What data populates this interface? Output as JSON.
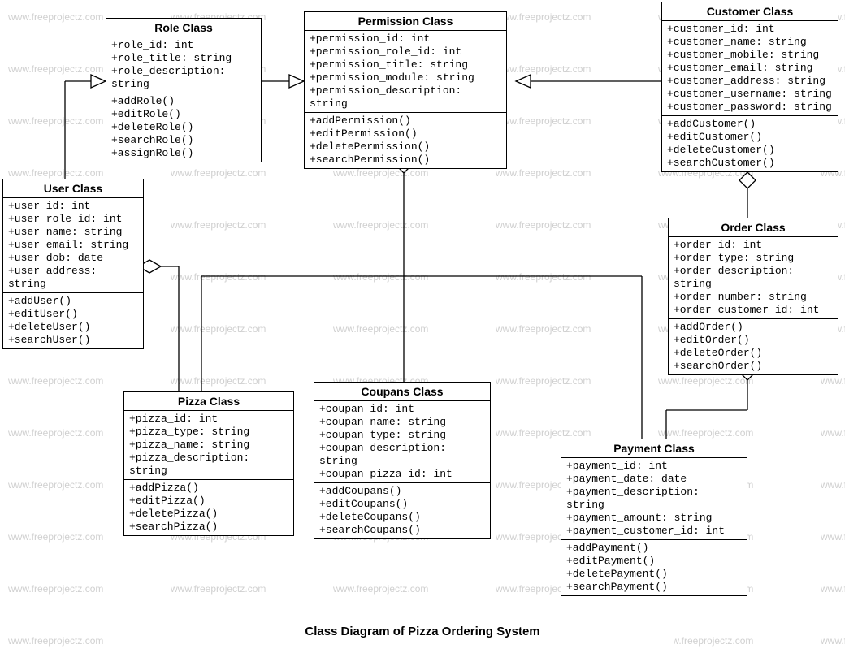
{
  "watermark": "www.freeprojectz.com",
  "caption": "Class Diagram of Pizza Ordering System",
  "classes": {
    "role": {
      "title": "Role Class",
      "attrs": [
        "+role_id: int",
        "+role_title: string",
        "+role_description: string"
      ],
      "ops": [
        "+addRole()",
        "+editRole()",
        "+deleteRole()",
        "+searchRole()",
        "+assignRole()"
      ]
    },
    "permission": {
      "title": "Permission Class",
      "attrs": [
        "+permission_id: int",
        "+permission_role_id: int",
        "+permission_title: string",
        "+permission_module: string",
        "+permission_description: string"
      ],
      "ops": [
        "+addPermission()",
        "+editPermission()",
        "+deletePermission()",
        "+searchPermission()"
      ]
    },
    "customer": {
      "title": "Customer Class",
      "attrs": [
        "+customer_id: int",
        "+customer_name: string",
        "+customer_mobile: string",
        "+customer_email: string",
        "+customer_address: string",
        "+customer_username: string",
        "+customer_password: string"
      ],
      "ops": [
        "+addCustomer()",
        "+editCustomer()",
        "+deleteCustomer()",
        "+searchCustomer()"
      ]
    },
    "user": {
      "title": "User Class",
      "attrs": [
        "+user_id: int",
        "+user_role_id: int",
        "+user_name: string",
        "+user_email: string",
        "+user_dob: date",
        "+user_address: string"
      ],
      "ops": [
        "+addUser()",
        "+editUser()",
        "+deleteUser()",
        "+searchUser()"
      ]
    },
    "order": {
      "title": "Order Class",
      "attrs": [
        "+order_id: int",
        "+order_type: string",
        "+order_description: string",
        "+order_number: string",
        "+order_customer_id: int"
      ],
      "ops": [
        "+addOrder()",
        "+editOrder()",
        "+deleteOrder()",
        "+searchOrder()"
      ]
    },
    "pizza": {
      "title": "Pizza Class",
      "attrs": [
        "+pizza_id: int",
        "+pizza_type: string",
        "+pizza_name: string",
        "+pizza_description: string"
      ],
      "ops": [
        "+addPizza()",
        "+editPizza()",
        "+deletePizza()",
        "+searchPizza()"
      ]
    },
    "coupans": {
      "title": "Coupans  Class",
      "attrs": [
        "+coupan_id: int",
        "+coupan_name: string",
        "+coupan_type: string",
        "+coupan_description: string",
        "+coupan_pizza_id: int"
      ],
      "ops": [
        "+addCoupans()",
        "+editCoupans()",
        "+deleteCoupans()",
        "+searchCoupans()"
      ]
    },
    "payment": {
      "title": "Payment Class",
      "attrs": [
        "+payment_id: int",
        "+payment_date: date",
        "+payment_description: string",
        "+payment_amount: string",
        "+payment_customer_id: int"
      ],
      "ops": [
        "+addPayment()",
        "+editPayment()",
        "+deletePayment()",
        "+searchPayment()"
      ]
    }
  }
}
